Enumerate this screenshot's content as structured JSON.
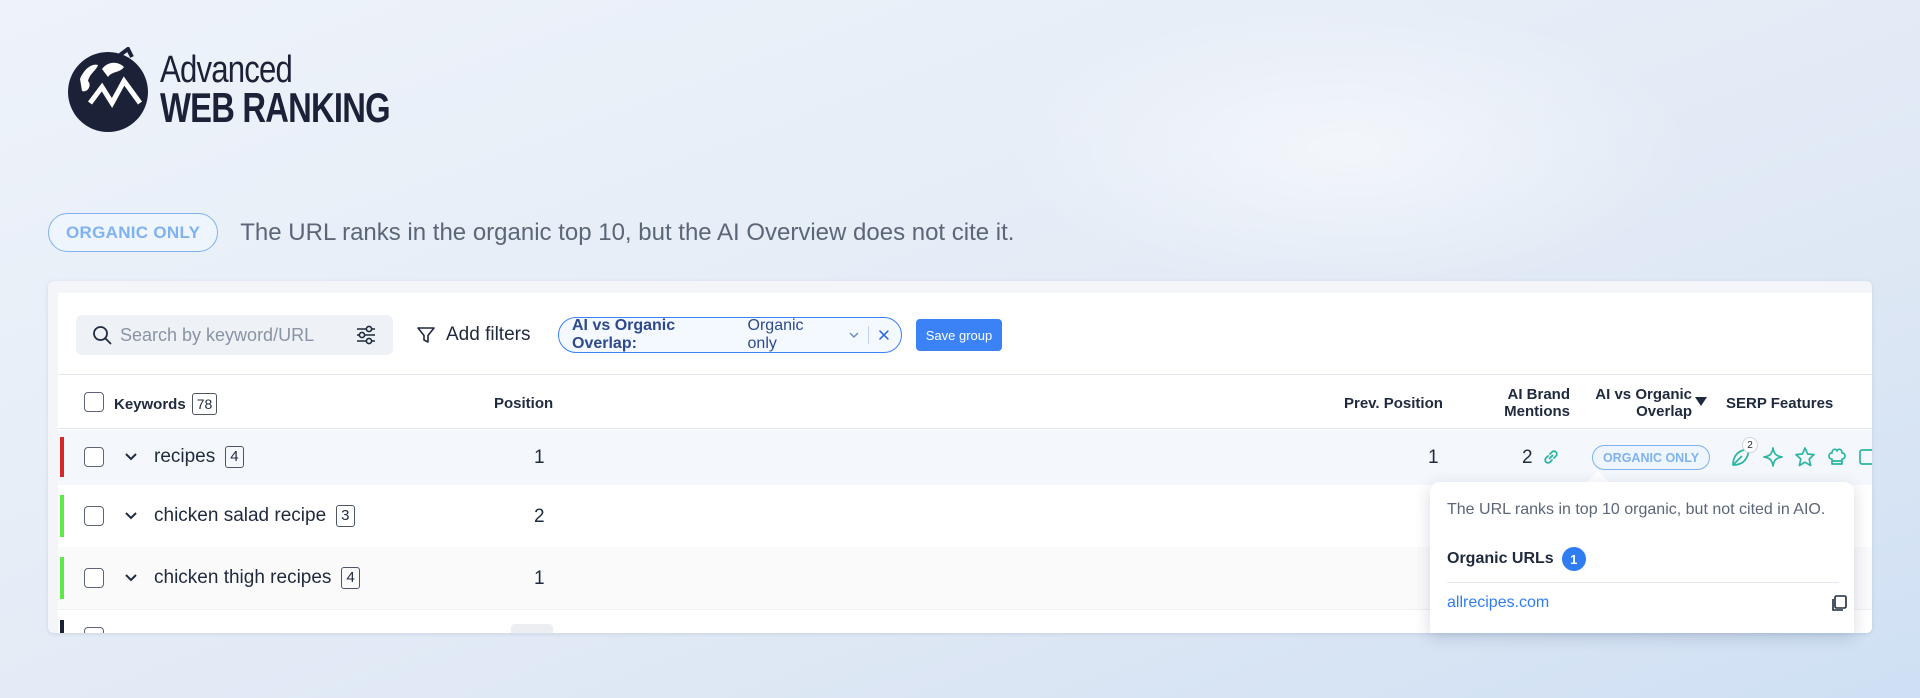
{
  "logo": {
    "line1": "Advanced",
    "line2": "WEB RANKING"
  },
  "legend": {
    "pill": "ORGANIC ONLY",
    "description": "The URL ranks in the organic top 10, but the AI Overview does not cite it."
  },
  "toolbar": {
    "search_placeholder": "Search by keyword/URL",
    "add_filters": "Add filters",
    "filter_chip": {
      "label": "AI vs Organic Overlap:",
      "value": "Organic only"
    },
    "save_group": "Save group"
  },
  "table": {
    "headers": {
      "keywords": "Keywords",
      "keywords_count": "78",
      "position": "Position",
      "prev_position": "Prev. Position",
      "ai_brand_line1": "AI Brand",
      "ai_brand_line2": "Mentions",
      "overlap_line1": "AI vs Organic",
      "overlap_line2": "Overlap",
      "serp_features": "SERP Features"
    },
    "rows": [
      {
        "keyword": "recipes",
        "count": "4",
        "position": "1",
        "prev_position": "1",
        "ai_brand_mentions": "2",
        "overlap": "ORGANIC ONLY",
        "serp_badge": "2",
        "bar_color": "#d62828"
      },
      {
        "keyword": "chicken salad recipe",
        "count": "3",
        "position": "2",
        "bar_color": "#5ee84a"
      },
      {
        "keyword": "chicken thigh recipes",
        "count": "4",
        "position": "1",
        "bar_color": "#5ee84a"
      }
    ]
  },
  "tooltip": {
    "description": "The URL ranks in top 10 organic, but not cited in AIO.",
    "heading": "Organic URLs",
    "count": "1",
    "url": "allrecipes.com"
  }
}
